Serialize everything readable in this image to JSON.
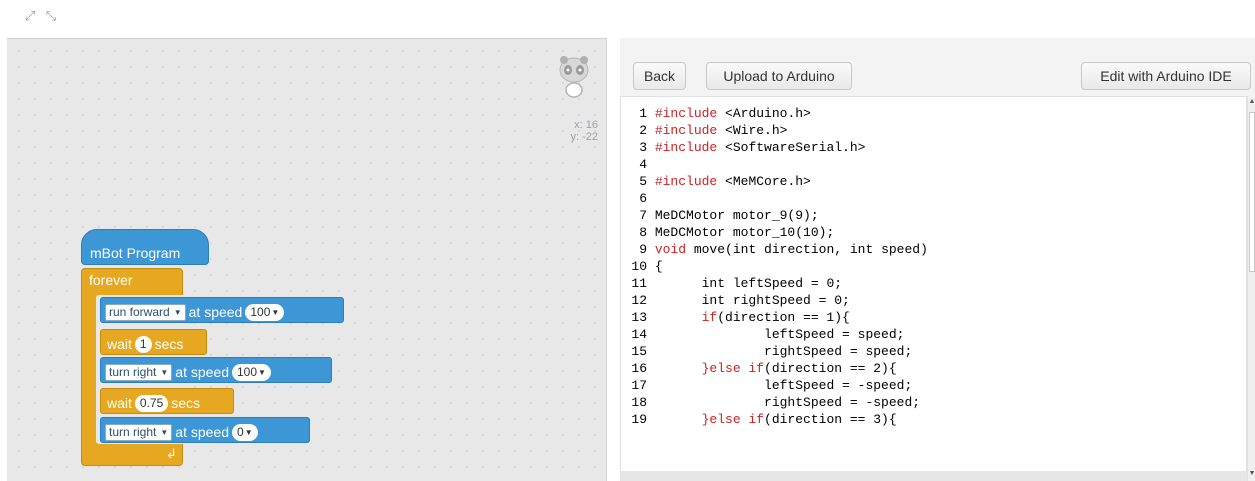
{
  "toolbar": {
    "fullscreen_icon": "expand-arrows-icon",
    "shrink_icon": "shrink-arrows-icon"
  },
  "stage": {
    "sprite_icon": "panda-icon",
    "x_readout": "x: 16",
    "y_readout": "y: -22"
  },
  "blocks": {
    "hat_label": "mBot Program",
    "forever_label": "forever",
    "run_dir": "run forward",
    "at_speed": "at speed",
    "speed1": "100",
    "wait": "wait",
    "secs": "secs",
    "wait1_value": "1",
    "turn_dir1": "turn right",
    "speed2": "100",
    "wait2_value": "0.75",
    "turn_dir2": "turn right",
    "speed3": "0",
    "loop_arrow_icon": "loop-return-arrow-icon"
  },
  "code_panel": {
    "back_label": "Back",
    "upload_label": "Upload to Arduino",
    "edit_label": "Edit with Arduino IDE"
  },
  "code": [
    {
      "n": "1",
      "kw": "#include",
      "rest": " <Arduino.h>"
    },
    {
      "n": "2",
      "kw": "#include",
      "rest": " <Wire.h>"
    },
    {
      "n": "3",
      "kw": "#include",
      "rest": " <SoftwareSerial.h>"
    },
    {
      "n": "4",
      "kw": "",
      "rest": ""
    },
    {
      "n": "5",
      "kw": "#include",
      "rest": " <MeMCore.h>"
    },
    {
      "n": "6",
      "kw": "",
      "rest": ""
    },
    {
      "n": "7",
      "kw": "",
      "rest": "MeDCMotor motor_9(9);"
    },
    {
      "n": "8",
      "kw": "",
      "rest": "MeDCMotor motor_10(10);"
    },
    {
      "n": "9",
      "kw": "void",
      "rest": " move(int direction, int speed)"
    },
    {
      "n": "10",
      "kw": "",
      "rest": "{"
    },
    {
      "n": "11",
      "kw": "",
      "rest": "      int leftSpeed = 0;"
    },
    {
      "n": "12",
      "kw": "",
      "rest": "      int rightSpeed = 0;"
    },
    {
      "n": "13",
      "pre": "      ",
      "kw": "if",
      "rest": "(direction == 1){"
    },
    {
      "n": "14",
      "kw": "",
      "rest": "              leftSpeed = speed;"
    },
    {
      "n": "15",
      "kw": "",
      "rest": "              rightSpeed = speed;"
    },
    {
      "n": "16",
      "pre": "      ",
      "kw": "}else if",
      "rest": "(direction == 2){"
    },
    {
      "n": "17",
      "kw": "",
      "rest": "              leftSpeed = -speed;"
    },
    {
      "n": "18",
      "kw": "",
      "rest": "              rightSpeed = -speed;"
    },
    {
      "n": "19",
      "pre": "      ",
      "kw": "}else if",
      "rest": "(direction == 3){"
    }
  ],
  "colors": {
    "motion_block": "#3d97d6",
    "control_block": "#e6a820",
    "keyword": "#cc2222"
  }
}
